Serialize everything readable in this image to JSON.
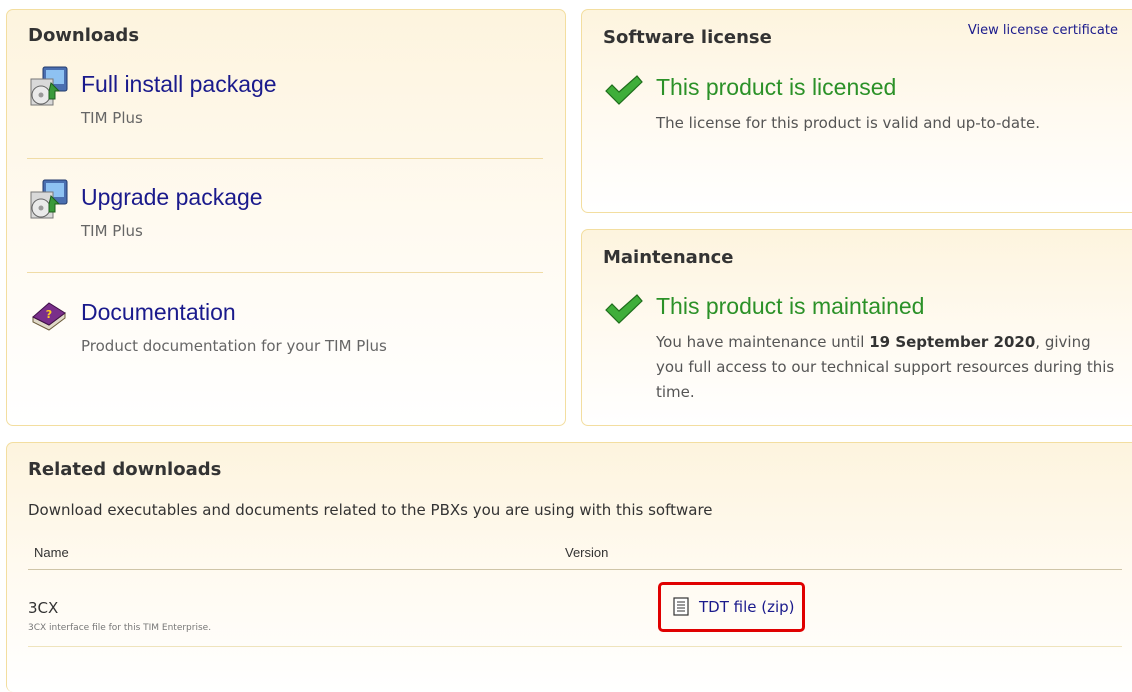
{
  "downloads": {
    "title": "Downloads",
    "items": [
      {
        "icon": "install-package-icon",
        "label": "Full install package",
        "subtitle": "TIM Plus"
      },
      {
        "icon": "upgrade-package-icon",
        "label": "Upgrade package",
        "subtitle": "TIM Plus"
      },
      {
        "icon": "documentation-book-icon",
        "label": "Documentation",
        "subtitle": "Product documentation for your TIM Plus"
      }
    ]
  },
  "license": {
    "title": "Software license",
    "certificate_link": "View license certificate",
    "status_title": "This product is licensed",
    "status_text": "The license for this product is valid and up-to-date."
  },
  "maintenance": {
    "title": "Maintenance",
    "status_title": "This product is maintained",
    "text_before": "You have maintenance until ",
    "date": "19 September 2020",
    "text_after": ", giving you full access to our technical support resources during this time."
  },
  "related": {
    "title": "Related downloads",
    "description": "Download executables and documents related to the PBXs you are using with this software",
    "columns": {
      "name": "Name",
      "version": "Version"
    },
    "rows": [
      {
        "name": "3CX",
        "description": "3CX interface file for this TIM Enterprise.",
        "file_link": "TDT file (zip)"
      }
    ]
  },
  "colors": {
    "panel_border": "#f3dea0",
    "link": "#1a1a8c",
    "status_green": "#2b9128",
    "highlight_red": "#e00000"
  }
}
